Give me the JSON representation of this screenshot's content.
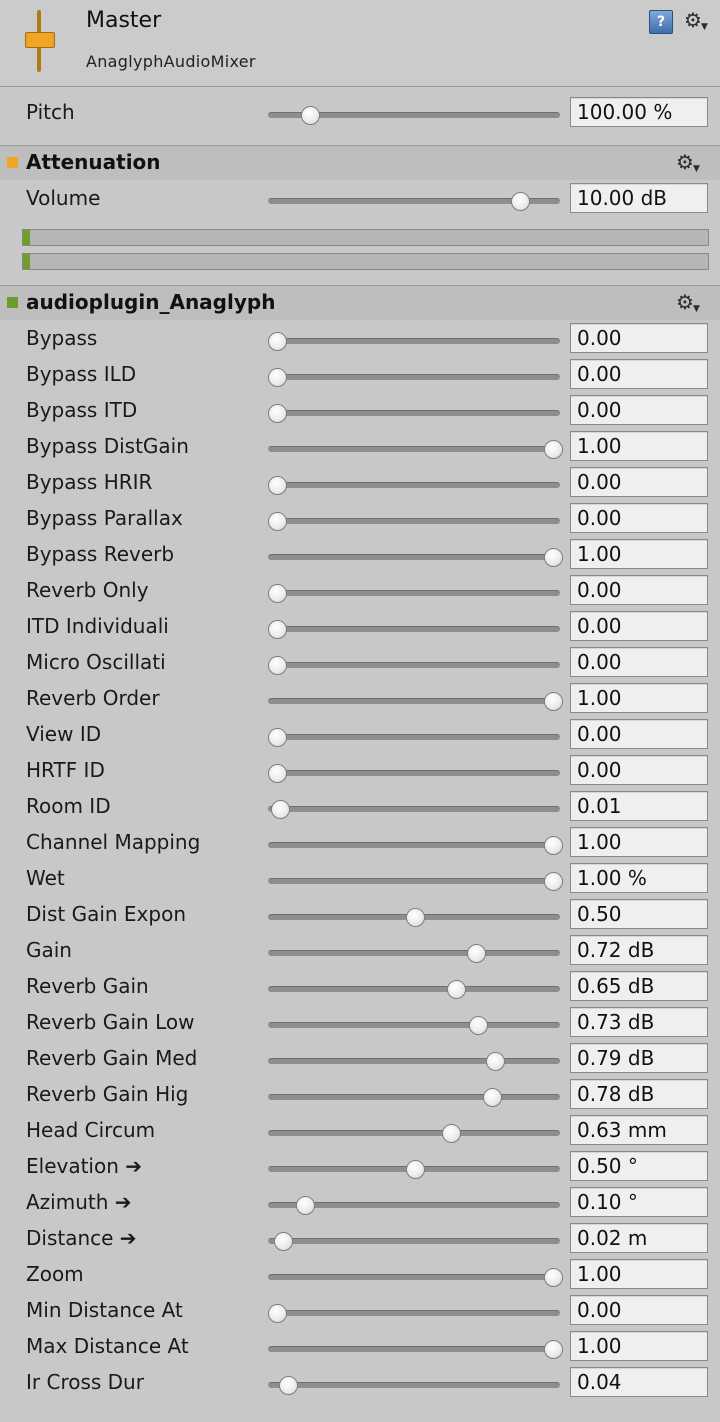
{
  "header": {
    "title": "Master",
    "subtitle": "AnaglyphAudioMixer",
    "help_icon": "help-book-icon",
    "settings_icon": "gear-icon"
  },
  "pitch": {
    "label": "Pitch",
    "value": "100.00 %",
    "position": 0.12
  },
  "attenuation": {
    "title": "Attenuation",
    "color": "#f0a526",
    "volume": {
      "label": "Volume",
      "value": "10.00 dB",
      "position": 0.88
    },
    "meters": [
      0.01,
      0.01
    ]
  },
  "plugin": {
    "title": "audioplugin_Anaglyph",
    "color": "#6a9e2c",
    "params": [
      {
        "label": "Bypass",
        "value": "0.00",
        "position": 0.0
      },
      {
        "label": "Bypass ILD",
        "value": "0.00",
        "position": 0.0
      },
      {
        "label": "Bypass ITD",
        "value": "0.00",
        "position": 0.0
      },
      {
        "label": "Bypass DistGain",
        "value": "1.00",
        "position": 1.0
      },
      {
        "label": "Bypass HRIR",
        "value": "0.00",
        "position": 0.0
      },
      {
        "label": "Bypass Parallax",
        "value": "0.00",
        "position": 0.0
      },
      {
        "label": "Bypass Reverb",
        "value": "1.00",
        "position": 1.0
      },
      {
        "label": "Reverb Only",
        "value": "0.00",
        "position": 0.0
      },
      {
        "label": "ITD Individuali",
        "value": "0.00",
        "position": 0.0
      },
      {
        "label": "Micro Oscillati",
        "value": "0.00",
        "position": 0.0
      },
      {
        "label": "Reverb Order",
        "value": "1.00",
        "position": 1.0
      },
      {
        "label": "View ID",
        "value": "0.00",
        "position": 0.0
      },
      {
        "label": "HRTF ID",
        "value": "0.00",
        "position": 0.0
      },
      {
        "label": "Room ID",
        "value": "0.01",
        "position": 0.01
      },
      {
        "label": "Channel Mapping",
        "value": "1.00",
        "position": 1.0
      },
      {
        "label": "Wet",
        "value": "1.00 %",
        "position": 1.0
      },
      {
        "label": "Dist Gain Expon",
        "value": "0.50",
        "position": 0.5
      },
      {
        "label": "Gain",
        "value": "0.72 dB",
        "position": 0.72
      },
      {
        "label": "Reverb Gain",
        "value": "0.65 dB",
        "position": 0.65
      },
      {
        "label": "Reverb Gain Low",
        "value": "0.73 dB",
        "position": 0.73
      },
      {
        "label": "Reverb Gain Med",
        "value": "0.79 dB",
        "position": 0.79
      },
      {
        "label": "Reverb Gain Hig",
        "value": "0.78 dB",
        "position": 0.78
      },
      {
        "label": "Head Circum",
        "value": "0.63 mm",
        "position": 0.63
      },
      {
        "label": "Elevation ➔",
        "value": "0.50 °",
        "position": 0.5
      },
      {
        "label": "Azimuth ➔",
        "value": "0.10 °",
        "position": 0.1
      },
      {
        "label": "Distance ➔",
        "value": "0.02 m",
        "position": 0.02
      },
      {
        "label": "Zoom",
        "value": "1.00",
        "position": 1.0
      },
      {
        "label": "Min Distance At",
        "value": "0.00",
        "position": 0.0
      },
      {
        "label": "Max Distance At",
        "value": "1.00",
        "position": 1.0
      },
      {
        "label": "Ir Cross Dur",
        "value": "0.04",
        "position": 0.04
      }
    ]
  }
}
